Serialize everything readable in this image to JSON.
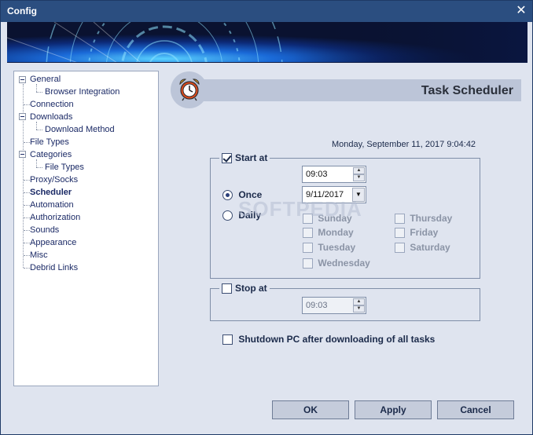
{
  "window": {
    "title": "Config"
  },
  "tree": {
    "items": [
      {
        "label": "General",
        "expandable": true
      },
      {
        "label": "Browser Integration"
      },
      {
        "label": "Connection"
      },
      {
        "label": "Downloads",
        "expandable": true
      },
      {
        "label": "Download Method"
      },
      {
        "label": "File Types"
      },
      {
        "label": "Categories",
        "expandable": true
      },
      {
        "label": "File Types"
      },
      {
        "label": "Proxy/Socks"
      },
      {
        "label": "Scheduler",
        "selected": true
      },
      {
        "label": "Automation"
      },
      {
        "label": "Authorization"
      },
      {
        "label": "Sounds"
      },
      {
        "label": "Appearance"
      },
      {
        "label": "Misc"
      },
      {
        "label": "Debrid Links"
      }
    ]
  },
  "header": {
    "title": "Task Scheduler",
    "icon": "alarm-clock-icon"
  },
  "datetime": "Monday, September 11, 2017 9:04:42",
  "start_at": {
    "label": "Start at",
    "checked": true,
    "time": "09:03",
    "date": "9/11/2017",
    "once_label": "Once",
    "daily_label": "Daily",
    "mode": "once",
    "days": [
      "Sunday",
      "Monday",
      "Tuesday",
      "Wednesday",
      "Thursday",
      "Friday",
      "Saturday"
    ]
  },
  "stop_at": {
    "label": "Stop at",
    "checked": false,
    "time": "09:03"
  },
  "shutdown": {
    "label": "Shutdown PC after downloading of all tasks",
    "checked": false
  },
  "buttons": {
    "ok": "OK",
    "apply": "Apply",
    "cancel": "Cancel"
  },
  "watermark": "SOFTPEDIA",
  "colors": {
    "titlebar": "#2b4e80",
    "background": "#dfe4ef",
    "header_bar": "#bcc5d8"
  }
}
